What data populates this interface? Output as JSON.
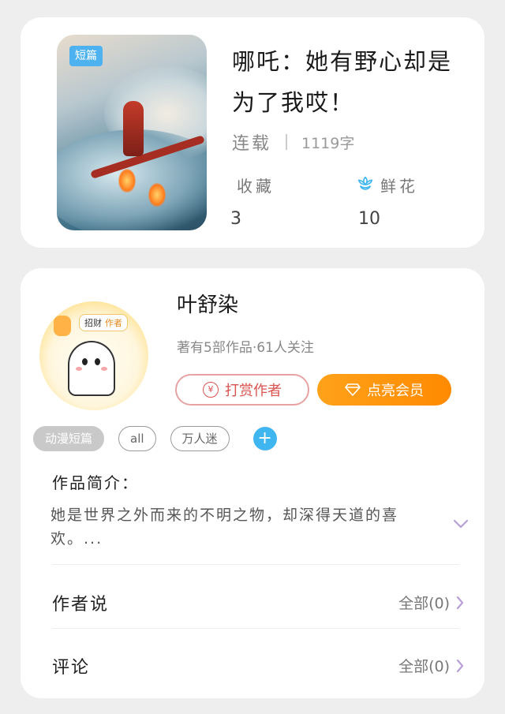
{
  "book": {
    "cover_badge": "短篇",
    "title": "哪吒：她有野心却是为了我哎！",
    "status": "连载",
    "word_count": "1119字",
    "favorites_label": "收藏",
    "favorites_value": "3",
    "flowers_label": "鲜花",
    "flowers_value": "10"
  },
  "author": {
    "avatar_tag_text": "招财",
    "avatar_tag_highlight": "作者",
    "name": "叶舒染",
    "meta": "著有5部作品·61人关注",
    "tip_icon_glyph": "¥",
    "tip_label": "打赏作者",
    "vip_label": "点亮会员",
    "tags": [
      "动漫短篇",
      "all",
      "万人迷"
    ],
    "add_tag_glyph": "+"
  },
  "intro": {
    "title": "作品简介：",
    "text": "她是世界之外而来的不明之物，却深得天道的喜欢。..."
  },
  "sections": {
    "author_says_title": "作者说",
    "author_says_link": "全部(0)",
    "comments_title": "评论",
    "comments_link": "全部(0)"
  },
  "colors": {
    "accent_blue": "#3fb6f0",
    "vip_orange": "#ff8a00",
    "tip_red": "#d9534f",
    "chevron_purple": "#b8a0d6"
  },
  "icons": [
    "flower-icon",
    "coin-icon",
    "diamond-icon",
    "chevron-down-icon",
    "chevron-right-icon",
    "plus-icon"
  ]
}
